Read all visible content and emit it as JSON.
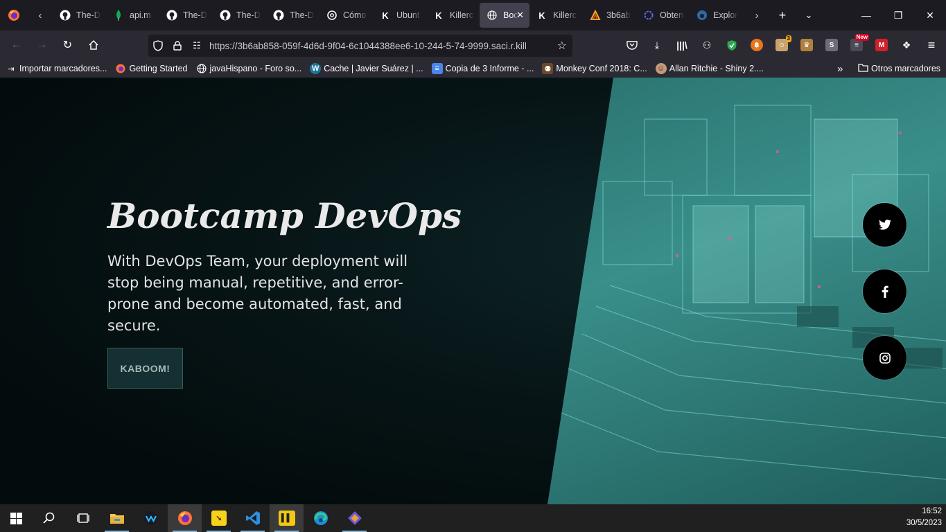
{
  "browser": {
    "tabs": [
      {
        "label": "The-D",
        "icon": "github-icon"
      },
      {
        "label": "api.m",
        "icon": "mongodb-leaf-icon"
      },
      {
        "label": "The-D",
        "icon": "github-icon"
      },
      {
        "label": "The-D",
        "icon": "github-icon"
      },
      {
        "label": "The-D",
        "icon": "github-icon"
      },
      {
        "label": "Cómo",
        "icon": "openai-icon"
      },
      {
        "label": "Ubunt",
        "icon": "killercoda-icon"
      },
      {
        "label": "Killerc",
        "icon": "killercoda-icon"
      },
      {
        "label": "Boo",
        "icon": "globe-icon",
        "active": true
      },
      {
        "label": "Killerc",
        "icon": "killercoda-icon"
      },
      {
        "label": "3b6ab",
        "icon": "bolt-icon"
      },
      {
        "label": "Obten",
        "icon": "ring-icon"
      },
      {
        "label": "Explor",
        "icon": "edge-icon"
      }
    ],
    "url": "https://3b6ab858-059f-4d6d-9f04-6c1044388ee6-10-244-5-74-9999.saci.r.kill",
    "toolbar_badges": {
      "ext_count": "3",
      "ext_new": "New"
    },
    "bookmarks": [
      {
        "label": "Importar marcadores...",
        "icon": "import-icon"
      },
      {
        "label": "Getting Started",
        "icon": "firefox-icon"
      },
      {
        "label": "javaHispano - Foro so...",
        "icon": "globe-icon"
      },
      {
        "label": "Cache | Javier Suárez | ...",
        "icon": "wordpress-icon"
      },
      {
        "label": "Copia de 3 Informe - ...",
        "icon": "docs-icon"
      },
      {
        "label": "Monkey Conf 2018: C...",
        "icon": "monkey-icon"
      },
      {
        "label": "Allan Ritchie - Shiny 2....",
        "icon": "avatar-icon"
      }
    ],
    "other_bookmarks": "Otros marcadores"
  },
  "hero": {
    "title": "Bootcamp DevOps",
    "text": "With DevOps Team, your deployment will stop being manual, repetitive, and error-prone and become automated, fast, and secure.",
    "cta": "KABOOM!"
  },
  "social": [
    {
      "name": "twitter-icon"
    },
    {
      "name": "facebook-icon"
    },
    {
      "name": "instagram-icon"
    }
  ],
  "taskbar": {
    "time": "16:52",
    "date": "30/5/2023"
  }
}
